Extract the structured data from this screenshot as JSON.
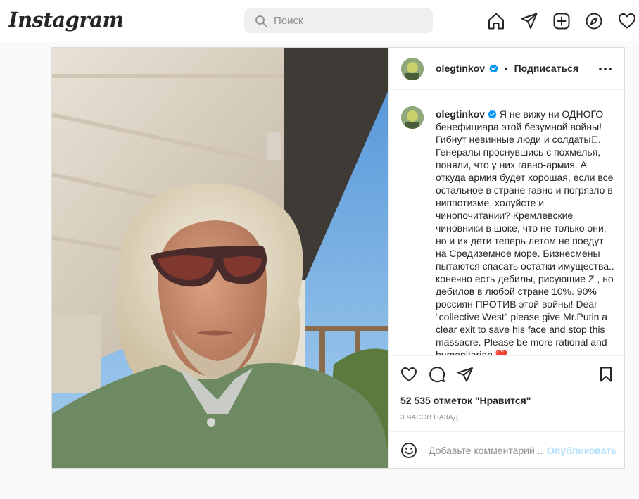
{
  "header": {
    "logo_text": "Instagram",
    "search_placeholder": "Поиск",
    "nav_icons": [
      "home-icon",
      "direct-icon",
      "new-post-icon",
      "explore-icon",
      "activity-icon"
    ]
  },
  "post": {
    "username": "olegtinkov",
    "verified": true,
    "separator": "•",
    "follow_label": "Подписаться",
    "caption": "Я не вижу ни ОДНОГО бенефициара этой безумной войны! Гибнут невинные люди и солдаты\u0000. Генералы проснувшись с похмелья, поняли, что у них гавно-армия. А откуда армия будет хорошая, если все остальное в стране гавно и погрязло в ниппотизме, холуйсте и чинопочитании? Кремлевские чиновники в шоке, что не только они, но и их дети теперь летом не поедут на Средиземное море. Бизнесмены пытаются спасать остатки имущества.. конечно есть дебилы, рисующие Z , но дебилов в любой стране 10%. 90% россиян ПРОТИВ этой войны! Dear “collective West” please give Mr.Putin a clear exit to save his face and stop this massacre. Please be more rational and humanitarian ❤️",
    "likes": "52 535 отметок \"Нравится\"",
    "time_ago": "3 часов назад",
    "comment_placeholder": "Добавьте комментарий...",
    "publish_label": "Опубликовать"
  },
  "colors": {
    "verified_blue": "#0095f6",
    "publish_disabled": "#b2dffc",
    "border": "#dbdbdb",
    "background": "#fafafa"
  }
}
